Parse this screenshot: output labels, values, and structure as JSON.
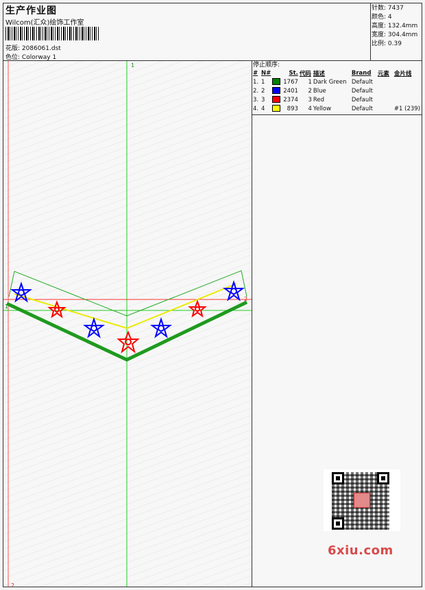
{
  "header": {
    "title": "生产作业图",
    "company": "Wilcom(汇众)绘饰工作室",
    "design_label": "花版:",
    "design_value": "2086061.dst",
    "colorway_label": "色位:",
    "colorway_value": "Colorway 1"
  },
  "stats": [
    {
      "label": "针数:",
      "value": "7437"
    },
    {
      "label": "颜色:",
      "value": "4"
    },
    {
      "label": "高度:",
      "value": "132.4mm"
    },
    {
      "label": "宽度:",
      "value": "304.4mm"
    },
    {
      "label": "比例:",
      "value": "0.39"
    }
  ],
  "stop_sequence": {
    "title": "停止顺序:",
    "columns": [
      "#",
      "N#",
      "St.",
      "代码",
      "描述",
      "Brand",
      "元素",
      "金片线"
    ],
    "rows": [
      {
        "idx": "1.",
        "needle": "1",
        "color": "#008000",
        "stitches": "1767",
        "code": "1",
        "desc": "Dark Green",
        "brand": "Default",
        "element": "",
        "sequin": ""
      },
      {
        "idx": "2.",
        "needle": "2",
        "color": "#0000ff",
        "stitches": "2401",
        "code": "2",
        "desc": "Blue",
        "brand": "Default",
        "element": "",
        "sequin": ""
      },
      {
        "idx": "3.",
        "needle": "3",
        "color": "#ff0000",
        "stitches": "2374",
        "code": "3",
        "desc": "Red",
        "brand": "Default",
        "element": "",
        "sequin": ""
      },
      {
        "idx": "4.",
        "needle": "4",
        "color": "#ffff00",
        "stitches": "893",
        "code": "4",
        "desc": "Yellow",
        "brand": "Default",
        "element": "",
        "sequin": "#1 (239)"
      }
    ]
  },
  "canvas": {
    "axis_top": "1",
    "axis_bottom": "2",
    "marker_left": "1",
    "marker_right": "2"
  },
  "watermark": {
    "brand": "6xiu.com"
  },
  "colors": {
    "green": "#008000",
    "blue": "#0000ff",
    "red": "#ff0000",
    "yellow": "#ffff00"
  }
}
